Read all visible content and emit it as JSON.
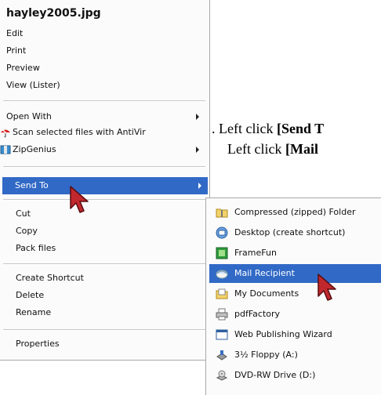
{
  "context_menu": {
    "items": [
      {
        "label": "hayley2005.jpg",
        "bold": true,
        "has_submenu": false
      },
      {
        "label": "Edit",
        "has_submenu": false
      },
      {
        "label": "Print",
        "has_submenu": false
      },
      {
        "label": "Preview",
        "has_submenu": false
      },
      {
        "label": "View (Lister)",
        "has_submenu": false
      },
      {
        "label": "Open With",
        "has_submenu": true
      },
      {
        "label": "Scan selected files with AntiVir",
        "icon": "antivir-umbrella-icon",
        "has_submenu": false
      },
      {
        "label": "ZipGenius",
        "icon": "zipgenius-icon",
        "has_submenu": true
      },
      {
        "label": "Send To",
        "has_submenu": true,
        "selected": true
      },
      {
        "label": "Cut",
        "has_submenu": false
      },
      {
        "label": "Copy",
        "has_submenu": false
      },
      {
        "label": "Pack files",
        "has_submenu": false
      },
      {
        "label": "Create Shortcut",
        "has_submenu": false
      },
      {
        "label": "Delete",
        "has_submenu": false
      },
      {
        "label": "Rename",
        "has_submenu": false
      },
      {
        "label": "Properties",
        "has_submenu": false
      }
    ]
  },
  "send_to_menu": {
    "items": [
      {
        "label": "Compressed (zipped) Folder",
        "icon": "zip-folder-icon"
      },
      {
        "label": "Desktop (create shortcut)",
        "icon": "desktop-icon"
      },
      {
        "label": "FrameFun",
        "icon": "framefun-icon"
      },
      {
        "label": "Mail Recipient",
        "icon": "mail-icon",
        "selected": true
      },
      {
        "label": "My Documents",
        "icon": "my-documents-icon"
      },
      {
        "label": "pdfFactory",
        "icon": "printer-icon"
      },
      {
        "label": "Web Publishing Wizard",
        "icon": "web-publishing-icon"
      },
      {
        "label": "3½ Floppy (A:)",
        "icon": "floppy-drive-icon"
      },
      {
        "label": "DVD-RW Drive (D:)",
        "icon": "dvd-drive-icon"
      }
    ]
  },
  "instructions": {
    "line1_prefix": ". Left click ",
    "line1_bold": "[Send T",
    "line2_prefix": "Left click  ",
    "line2_bold": "[Mail"
  },
  "colors": {
    "highlight": "#3169c6",
    "menu_bg": "#fbfbfb",
    "cursor_red": "#c0282d"
  }
}
